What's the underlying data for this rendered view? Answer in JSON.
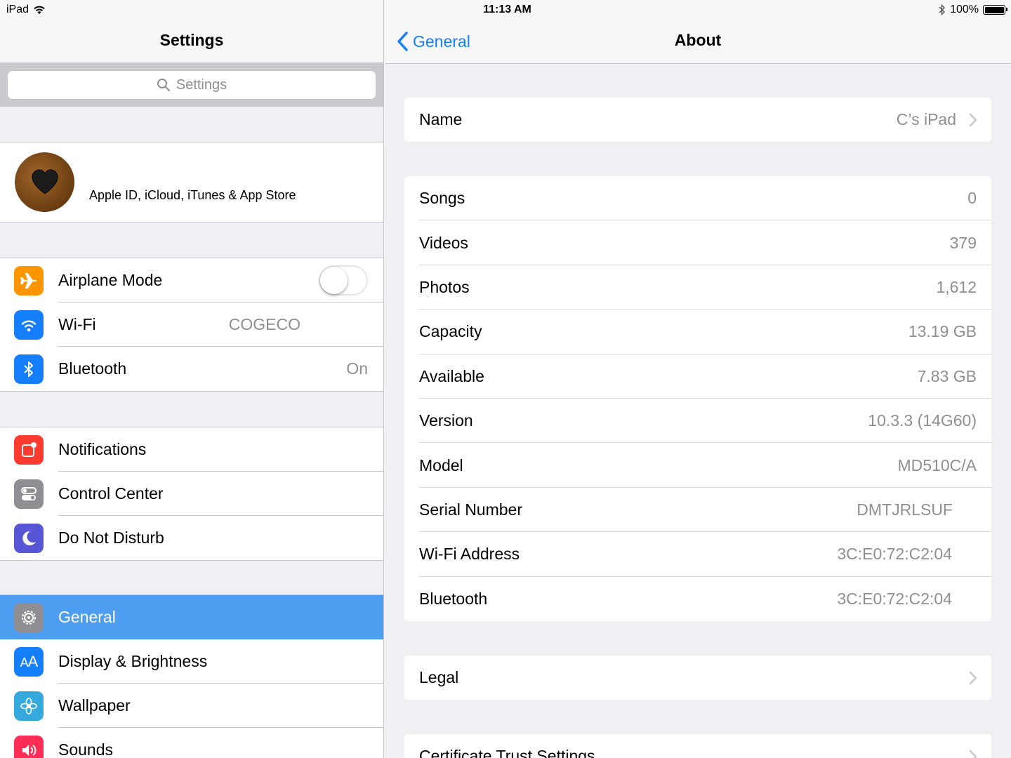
{
  "status_bar": {
    "device": "iPad",
    "time": "11:13 AM",
    "battery": "100%"
  },
  "master": {
    "title": "Settings",
    "search_placeholder": "Settings",
    "profile_subtitle": "Apple ID, iCloud, iTunes & App Store",
    "group1": [
      {
        "label": "Airplane Mode",
        "value": "",
        "icon": "airplane-icon",
        "color": "#ff9500"
      },
      {
        "label": "Wi-Fi",
        "value": "COGECO",
        "icon": "wifi-icon",
        "color": "#157efb"
      },
      {
        "label": "Bluetooth",
        "value": "On",
        "icon": "bluetooth-icon",
        "color": "#157efb"
      }
    ],
    "group2": [
      {
        "label": "Notifications",
        "icon": "notifications-icon",
        "color": "#ff3b30"
      },
      {
        "label": "Control Center",
        "icon": "control-center-icon",
        "color": "#8e8e93"
      },
      {
        "label": "Do Not Disturb",
        "icon": "moon-icon",
        "color": "#5856d6"
      }
    ],
    "group3": [
      {
        "label": "General",
        "icon": "gear-icon",
        "color": "#8e8e93",
        "selected": true
      },
      {
        "label": "Display & Brightness",
        "icon": "display-brightness-icon",
        "color": "#157efb"
      },
      {
        "label": "Wallpaper",
        "icon": "wallpaper-icon",
        "color": "#34aadc"
      },
      {
        "label": "Sounds",
        "icon": "sounds-icon",
        "color": "#ff2d55"
      }
    ]
  },
  "detail": {
    "back_label": "General",
    "title": "About",
    "name_row": {
      "label": "Name",
      "value": "C’s iPad"
    },
    "info_rows": [
      {
        "label": "Songs",
        "value": "0"
      },
      {
        "label": "Videos",
        "value": "379"
      },
      {
        "label": "Photos",
        "value": "1,612"
      },
      {
        "label": "Capacity",
        "value": "13.19 GB"
      },
      {
        "label": "Available",
        "value": "7.83 GB"
      },
      {
        "label": "Version",
        "value": "10.3.3 (14G60)"
      },
      {
        "label": "Model",
        "value": "MD510C/A"
      },
      {
        "label": "Serial Number",
        "value": "DMTJRLSUF"
      },
      {
        "label": "Wi-Fi Address",
        "value": "3C:E0:72:C2:04"
      },
      {
        "label": "Bluetooth",
        "value": "3C:E0:72:C2:04"
      }
    ],
    "legal_label": "Legal",
    "cert_label": "Certificate Trust Settings"
  },
  "colors": {
    "accent": "#157efb",
    "selected_row": "#4d9df0"
  }
}
